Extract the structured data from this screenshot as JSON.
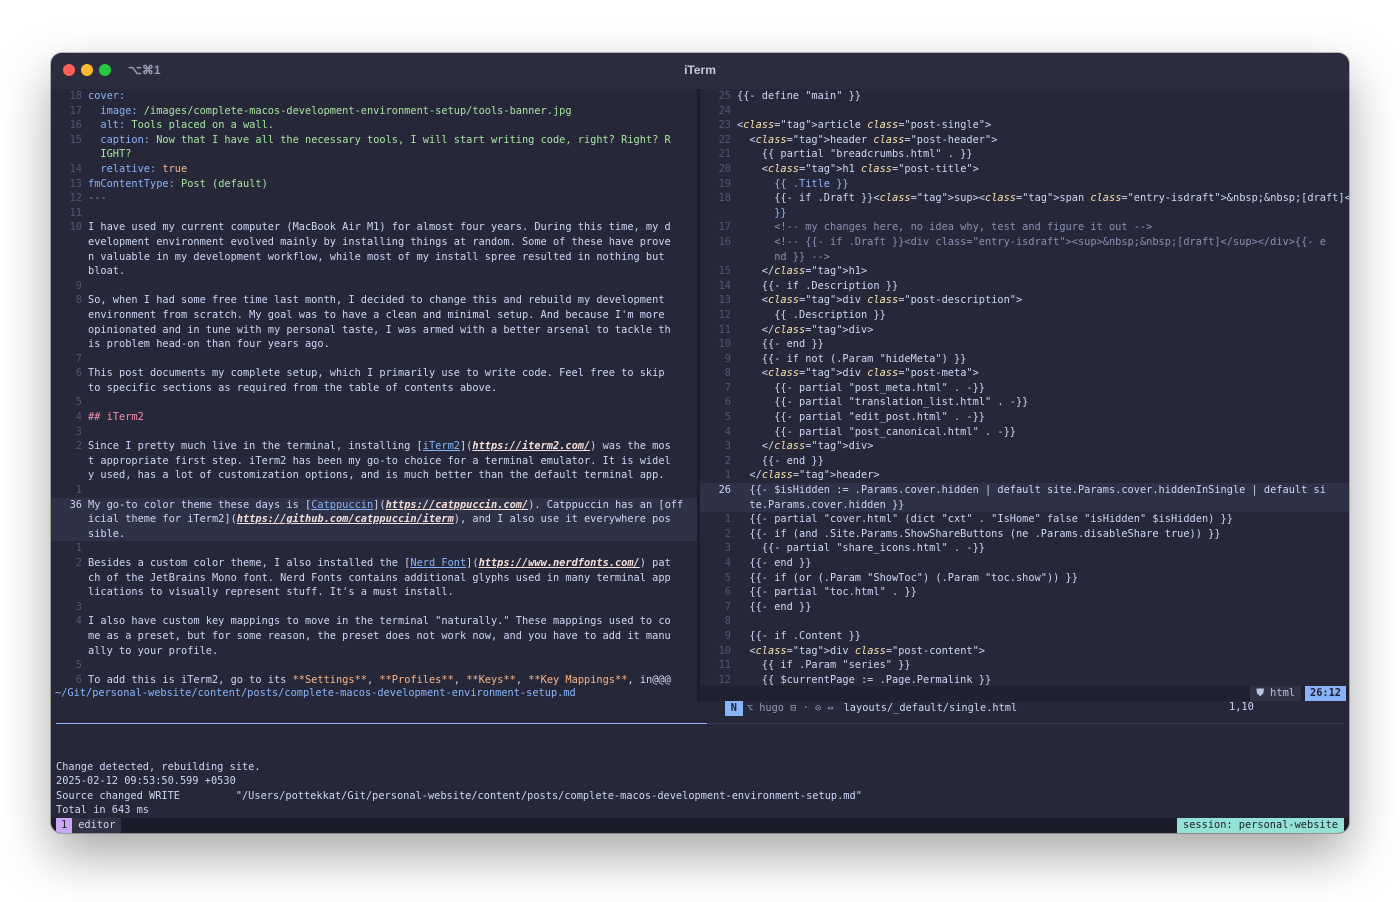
{
  "window": {
    "shortcut": "⌥⌘1",
    "title": "iTerm"
  },
  "left_pane": {
    "lines": [
      {
        "n": "18",
        "t": "cover:",
        "c": "key"
      },
      {
        "n": "17",
        "t": "  image: /images/complete-macos-development-environment-setup/tools-banner.jpg",
        "c": "str"
      },
      {
        "n": "16",
        "t": "  alt: Tools placed on a wall.",
        "c": "str"
      },
      {
        "n": "15",
        "t": "  caption: Now that I have all the necessary tools, I will start writing code, right? Right? R",
        "c": "str"
      },
      {
        "n": "",
        "t": "  IGHT?",
        "c": "str"
      },
      {
        "n": "14",
        "t": "  relative: true",
        "c": "bool"
      },
      {
        "n": "13",
        "t": "fmContentType: Post (default)",
        "c": "str"
      },
      {
        "n": "12",
        "t": "---",
        "c": "cmt"
      },
      {
        "n": "11",
        "t": "",
        "c": ""
      },
      {
        "n": "10",
        "t": "I have used my current computer (MacBook Air M1) for almost four years. During this time, my d",
        "c": ""
      },
      {
        "n": "",
        "t": "evelopment environment evolved mainly by installing things at random. Some of these have prove",
        "c": ""
      },
      {
        "n": "",
        "t": "n valuable in my development workflow, while most of my install spree resulted in nothing but",
        "c": ""
      },
      {
        "n": "",
        "t": "bloat.",
        "c": ""
      },
      {
        "n": "9",
        "t": "",
        "c": ""
      },
      {
        "n": "8",
        "t": "So, when I had some free time last month, I decided to change this and rebuild my development",
        "c": ""
      },
      {
        "n": "",
        "t": "environment from scratch. My goal was to have a clean and minimal setup. And because I'm more",
        "c": ""
      },
      {
        "n": "",
        "t": "opinionated and in tune with my personal taste, I was armed with a better arsenal to tackle th",
        "c": ""
      },
      {
        "n": "",
        "t": "is problem head-on than four years ago.",
        "c": ""
      },
      {
        "n": "7",
        "t": "",
        "c": ""
      },
      {
        "n": "6",
        "t": "This post documents my complete setup, which I primarily use to write code. Feel free to skip",
        "c": ""
      },
      {
        "n": "",
        "t": "to specific sections as required from the table of contents above.",
        "c": ""
      },
      {
        "n": "5",
        "t": "",
        "c": ""
      },
      {
        "n": "4",
        "t": "## iTerm2",
        "c": "hd"
      },
      {
        "n": "3",
        "t": "",
        "c": ""
      },
      {
        "n": "2",
        "t": "Since I pretty much live in the terminal, installing [iTerm2](https://iterm2.com/) was the mos",
        "c": "md1"
      },
      {
        "n": "",
        "t": "t appropriate first step. iTerm2 has been my go-to choice for a terminal emulator. It is widel",
        "c": ""
      },
      {
        "n": "",
        "t": "y used, has a lot of customization options, and is much better than the default terminal app.",
        "c": ""
      },
      {
        "n": "1",
        "t": "",
        "c": ""
      },
      {
        "n": "36",
        "t": "My go-to color theme these days is [Catppuccin](https://catppuccin.com/). Catppuccin has an [off",
        "c": "md2",
        "cur": true
      },
      {
        "n": "",
        "t": "icial theme for iTerm2](https://github.com/catppuccin/iterm), and I also use it everywhere pos",
        "c": "md3",
        "cur": true
      },
      {
        "n": "",
        "t": "sible.",
        "c": "",
        "cur": true
      },
      {
        "n": "1",
        "t": "",
        "c": ""
      },
      {
        "n": "2",
        "t": "Besides a custom color theme, I also installed the [Nerd Font](https://www.nerdfonts.com/) pat",
        "c": "md4"
      },
      {
        "n": "",
        "t": "ch of the JetBrains Mono font. Nerd Fonts contains additional glyphs used in many terminal app",
        "c": ""
      },
      {
        "n": "",
        "t": "lications to visually represent stuff. It's a must install.",
        "c": ""
      },
      {
        "n": "3",
        "t": "",
        "c": ""
      },
      {
        "n": "4",
        "t": "I also have custom key mappings to move in the terminal \"naturally.\" These mappings used to co",
        "c": ""
      },
      {
        "n": "",
        "t": "me as a preset, but for some reason, the preset does not work now, and you have to add it manu",
        "c": ""
      },
      {
        "n": "",
        "t": "ally to your profile.",
        "c": ""
      },
      {
        "n": "5",
        "t": "",
        "c": ""
      },
      {
        "n": "6",
        "t": "To add this is iTerm2, go to its **Settings**, **Profiles**, **Keys**, **Key Mappings**, in@@@",
        "c": "md5"
      }
    ],
    "status_path": "~/Git/personal-website/content/posts/complete-macos-development-environment-setup.md"
  },
  "right_pane": {
    "lines": [
      {
        "n": "25",
        "t": "{{- define \"main\" }}",
        "c": ""
      },
      {
        "n": "24",
        "t": "",
        "c": ""
      },
      {
        "n": "23",
        "t": "<article class=\"post-single\">",
        "c": "h"
      },
      {
        "n": "22",
        "t": "  <header class=\"post-header\">",
        "c": "h"
      },
      {
        "n": "21",
        "t": "    {{ partial \"breadcrumbs.html\" . }}",
        "c": ""
      },
      {
        "n": "20",
        "t": "    <h1 class=\"post-title\">",
        "c": "h"
      },
      {
        "n": "19",
        "t": "      {{ .Title }}",
        "c": "tpl"
      },
      {
        "n": "18",
        "t": "      {{- if .Draft }}<sup><span class=\"entry-isdraft\">&nbsp;&nbsp;[draft]</span></sup>{{- end",
        "c": "h"
      },
      {
        "n": "",
        "t": "      }}",
        "c": "tpl"
      },
      {
        "n": "17",
        "t": "      <!-- my changes here, no idea why, test and figure it out -->",
        "c": "cmt"
      },
      {
        "n": "16",
        "t": "      <!-- {{- if .Draft }}<div class=\"entry-isdraft\"><sup>&nbsp;&nbsp;[draft]</sup></div>{{- e",
        "c": "cmt"
      },
      {
        "n": "",
        "t": "      nd }} -->",
        "c": "cmt"
      },
      {
        "n": "15",
        "t": "    </h1>",
        "c": "h"
      },
      {
        "n": "14",
        "t": "    {{- if .Description }}",
        "c": ""
      },
      {
        "n": "13",
        "t": "    <div class=\"post-description\">",
        "c": "h"
      },
      {
        "n": "12",
        "t": "      {{ .Description }}",
        "c": ""
      },
      {
        "n": "11",
        "t": "    </div>",
        "c": "h"
      },
      {
        "n": "10",
        "t": "    {{- end }}",
        "c": ""
      },
      {
        "n": "9",
        "t": "    {{- if not (.Param \"hideMeta\") }}",
        "c": ""
      },
      {
        "n": "8",
        "t": "    <div class=\"post-meta\">",
        "c": "h"
      },
      {
        "n": "7",
        "t": "      {{- partial \"post_meta.html\" . -}}",
        "c": ""
      },
      {
        "n": "6",
        "t": "      {{- partial \"translation_list.html\" . -}}",
        "c": ""
      },
      {
        "n": "5",
        "t": "      {{- partial \"edit_post.html\" . -}}",
        "c": ""
      },
      {
        "n": "4",
        "t": "      {{- partial \"post_canonical.html\" . -}}",
        "c": ""
      },
      {
        "n": "3",
        "t": "    </div>",
        "c": "h"
      },
      {
        "n": "2",
        "t": "    {{- end }}",
        "c": ""
      },
      {
        "n": "1",
        "t": "  </header>",
        "c": "h"
      },
      {
        "n": "26",
        "t": "  {{- $isHidden := .Params.cover.hidden | default site.Params.cover.hiddenInSingle | default si",
        "c": "",
        "cur": true
      },
      {
        "n": "",
        "t": "  te.Params.cover.hidden }}",
        "c": "",
        "cur": true
      },
      {
        "n": "1",
        "t": "  {{- partial \"cover.html\" (dict \"cxt\" . \"IsHome\" false \"isHidden\" $isHidden) }}",
        "c": ""
      },
      {
        "n": "2",
        "t": "  {{- if (and .Site.Params.ShowShareButtons (ne .Params.disableShare true)) }}",
        "c": ""
      },
      {
        "n": "3",
        "t": "    {{- partial \"share_icons.html\" . -}}",
        "c": ""
      },
      {
        "n": "4",
        "t": "  {{- end }}",
        "c": ""
      },
      {
        "n": "5",
        "t": "  {{- if (or (.Param \"ShowToc\") (.Param \"toc.show\")) }}",
        "c": ""
      },
      {
        "n": "6",
        "t": "  {{- partial \"toc.html\" . }}",
        "c": ""
      },
      {
        "n": "7",
        "t": "  {{- end }}",
        "c": ""
      },
      {
        "n": "8",
        "t": "",
        "c": ""
      },
      {
        "n": "9",
        "t": "  {{- if .Content }}",
        "c": ""
      },
      {
        "n": "10",
        "t": "  <div class=\"post-content\">",
        "c": "h"
      },
      {
        "n": "11",
        "t": "    {{ if .Param \"series\" }}",
        "c": ""
      },
      {
        "n": "12",
        "t": "    {{ $currentPage := .Page.Permalink }}",
        "c": ""
      }
    ],
    "statusline": {
      "mode": "N",
      "branch": "⌥ hugo ⊟ · ⊙ ↔",
      "file": "layouts/_default/single.html",
      "filetype": "⛊ html",
      "position": "26:12"
    },
    "cmd_position": "1,10"
  },
  "log": [
    "",
    "Change detected, rebuilding site.",
    "2025-02-12 09:53:50.599 +0530",
    "Source changed WRITE         \"/Users/pottekkat/Git/personal-website/content/posts/complete-macos-development-environment-setup.md\"",
    "Total in 643 ms"
  ],
  "tmux": {
    "window_number": "1",
    "window_name": "editor",
    "session": "session: personal-website"
  },
  "colors": {
    "background": "#262839",
    "accent": "#89b4fa",
    "session": "#94e2d5",
    "window_index": "#cba6f7"
  }
}
